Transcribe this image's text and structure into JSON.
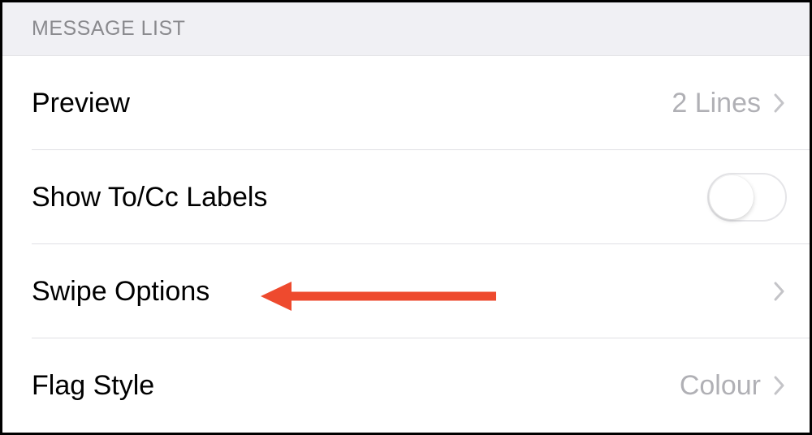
{
  "section": {
    "header": "MESSAGE LIST"
  },
  "rows": {
    "preview": {
      "label": "Preview",
      "value": "2 Lines"
    },
    "showToCc": {
      "label": "Show To/Cc Labels",
      "toggled": false
    },
    "swipeOptions": {
      "label": "Swipe Options"
    },
    "flagStyle": {
      "label": "Flag Style",
      "value": "Colour"
    }
  },
  "annotation": {
    "color": "#ee4a2e"
  }
}
